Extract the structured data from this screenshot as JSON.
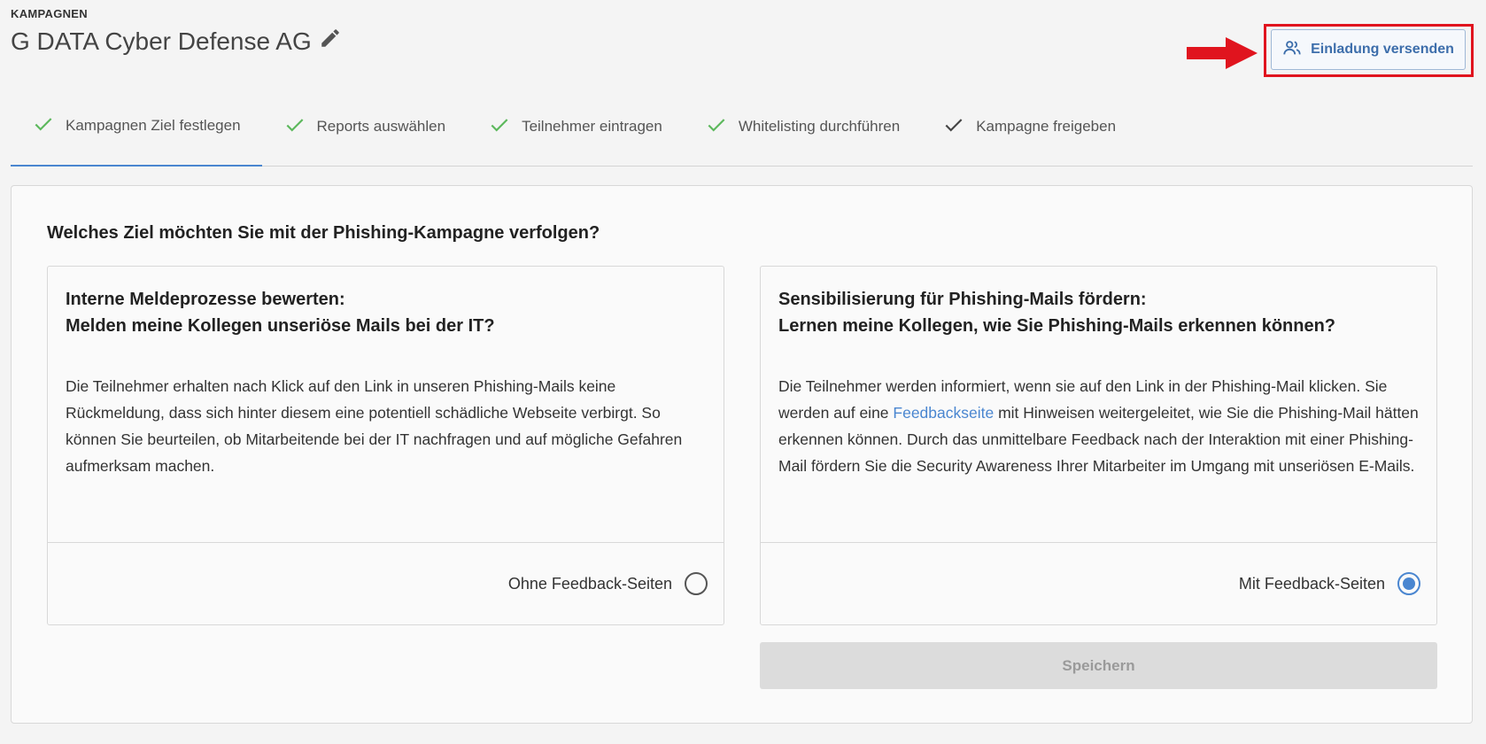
{
  "header": {
    "breadcrumb": "KAMPAGNEN",
    "title": "G DATA Cyber Defense AG",
    "edit_icon": "pencil-icon",
    "invite_button_label": "Einladung versenden",
    "invite_icon": "users-icon",
    "highlight_color": "#e0141e"
  },
  "steps": [
    {
      "label": "Kampagnen Ziel festlegen",
      "icon": "check-icon",
      "color": "#5cb85c"
    },
    {
      "label": "Reports auswählen",
      "icon": "check-icon",
      "color": "#5cb85c"
    },
    {
      "label": "Teilnehmer eintragen",
      "icon": "check-icon",
      "color": "#5cb85c"
    },
    {
      "label": "Whitelisting durchführen",
      "icon": "check-icon",
      "color": "#5cb85c"
    },
    {
      "label": "Kampagne freigeben",
      "icon": "check-icon",
      "color": "#444444"
    }
  ],
  "main": {
    "question": "Welches Ziel möchten Sie mit der Phishing-Kampagne verfolgen?",
    "cards": [
      {
        "title_line1": "Interne Meldeprozesse bewerten:",
        "title_line2": "Melden meine Kollegen unseriöse Mails bei der IT?",
        "body": "Die Teilnehmer erhalten nach Klick auf den Link in unseren Phishing-Mails keine Rückmeldung, dass sich hinter diesem eine potentiell schädliche Webseite verbirgt. So können Sie beurteilen, ob Mitarbeitende bei der IT nachfragen und auf mögliche Gefahren aufmerksam machen.",
        "option_label": "Ohne Feedback-Seiten",
        "selected": false
      },
      {
        "title_line1": "Sensibilisierung für Phishing-Mails fördern:",
        "title_line2": "Lernen meine Kollegen, wie Sie Phishing-Mails erkennen können?",
        "body_before_link": "Die Teilnehmer werden informiert, wenn sie auf den Link in der Phishing-Mail klicken. Sie werden auf eine ",
        "body_link": "Feedbackseite",
        "body_after_link": " mit Hinweisen weitergeleitet, wie Sie die Phishing-Mail hätten erkennen können. Durch das unmittelbare Feedback nach der Interaktion mit einer Phishing-Mail fördern Sie die Security Awareness Ihrer Mitarbeiter im Umgang mit unseriösen E-Mails.",
        "option_label": "Mit Feedback-Seiten",
        "selected": true
      }
    ],
    "save_label": "Speichern"
  }
}
